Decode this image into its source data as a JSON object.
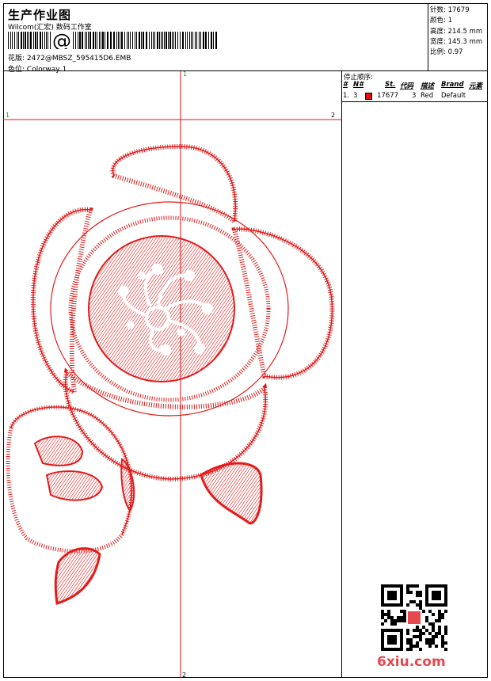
{
  "header": {
    "title": "生产作业图",
    "company": "Wilcom(汇宏) 数码工作室",
    "barcode_symbol": "@",
    "design_label": "花版:",
    "design_value": "2472@MBSZ_595415D6.EMB",
    "colorway_label": "色位:",
    "colorway_value": "Colorway 1"
  },
  "stats": [
    {
      "label": "针数:",
      "value": "17679"
    },
    {
      "label": "颜色:",
      "value": "1"
    },
    {
      "label": "高度:",
      "value": "214.5 mm"
    },
    {
      "label": "宽度:",
      "value": "145.3 mm"
    },
    {
      "label": "比例:",
      "value": "0.97"
    }
  ],
  "canvas": {
    "guide_color": "#d11515",
    "marker_color": "#11aa11",
    "markers": {
      "top": "1",
      "left": "1",
      "right": "2",
      "bottom": "2"
    }
  },
  "stop_sequence": {
    "title": "停止顺序:",
    "columns": [
      "#",
      "N#",
      "St.",
      "代码",
      "描述",
      "Brand",
      "元素"
    ],
    "rows": [
      {
        "index": "1.",
        "needle": "3",
        "stitches": "17677",
        "code": "3",
        "description": "Red",
        "brand": "Default",
        "swatch": "#e01010"
      }
    ]
  },
  "watermark": {
    "text": "6xiu.com",
    "color": "#e5484d"
  },
  "embroidery_color": "#e31b1b"
}
